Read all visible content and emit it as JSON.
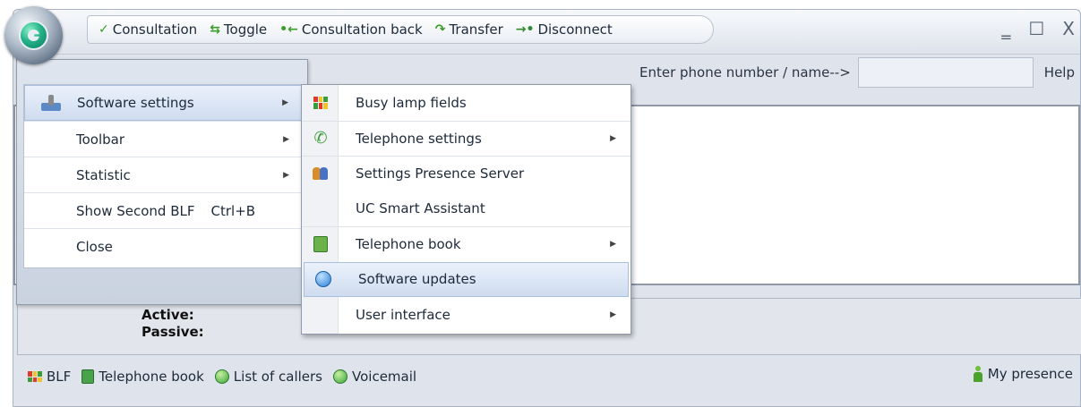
{
  "toolbar": {
    "items": [
      {
        "label": "Consultation",
        "icon": "consultation-icon"
      },
      {
        "label": "Toggle",
        "icon": "toggle-icon"
      },
      {
        "label": "Consultation back",
        "icon": "consultation-back-icon"
      },
      {
        "label": "Transfer",
        "icon": "transfer-icon"
      },
      {
        "label": "Disconnect",
        "icon": "disconnect-icon"
      }
    ]
  },
  "window_controls": {
    "minimize": "‗",
    "maximize": "☐",
    "close": "X"
  },
  "phone_search": {
    "label": "Enter phone number / name-->",
    "value": "",
    "help": "Help"
  },
  "app_menu": {
    "items": [
      {
        "label": "Software settings",
        "has_submenu": true,
        "highlighted": true
      },
      {
        "label": "Toolbar",
        "has_submenu": true
      },
      {
        "label": "Statistic",
        "has_submenu": true
      },
      {
        "label": "Show Second BLF",
        "shortcut": "Ctrl+B"
      },
      {
        "label": "Close"
      }
    ]
  },
  "submenu": {
    "items": [
      {
        "label": "Busy lamp fields",
        "icon": "blf-icon"
      },
      {
        "label": "Telephone settings",
        "icon": "telephone-icon",
        "has_submenu": true
      },
      {
        "label": "Settings Presence Server",
        "icon": "presence-server-icon"
      },
      {
        "label": "UC Smart Assistant",
        "icon": ""
      },
      {
        "label": "Telephone book",
        "icon": "phonebook-icon",
        "has_submenu": true
      },
      {
        "label": "Software updates",
        "icon": "globe-icon",
        "highlighted": true
      },
      {
        "label": "User interface",
        "icon": "",
        "has_submenu": true
      }
    ]
  },
  "status": {
    "active": "Active:",
    "passive": "Passive:"
  },
  "bottom_bar": {
    "blf": "BLF",
    "telephone_book": "Telephone book",
    "list_of_callers": "List of callers",
    "voicemail": "Voicemail",
    "my_presence": "My presence"
  },
  "colors": {
    "accent": "#2a7ed6",
    "green": "#3a9d3a",
    "highlight": "#cfdcef"
  }
}
